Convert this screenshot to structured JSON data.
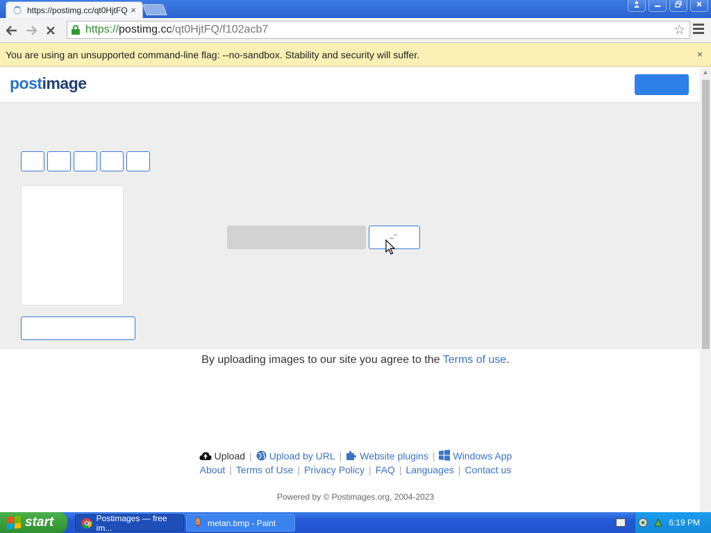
{
  "browser": {
    "tab_title": "https://postimg.cc/qt0HjtFQ",
    "tab_close": "×",
    "url_scheme": "https://",
    "url_host": "postimg.cc",
    "url_path": "/qt0HjtFQ/f102acb7"
  },
  "infobar": {
    "message": "You are using an unsupported command-line flag: --no-sandbox. Stability and security will suffer.",
    "close": "×"
  },
  "site": {
    "logo_part1": "post",
    "logo_part2": "image",
    "copy_button_label": "̶̶ ''",
    "terms_prefix": "By uploading images to our site you agree to the",
    "terms_link": "Terms of use",
    "terms_suffix": ".",
    "footer_row1": {
      "upload": "Upload",
      "upload_by_url": "Upload by URL",
      "website_plugins": "Website plugins",
      "windows_app": "Windows App"
    },
    "footer_row2": [
      "About",
      "Terms of Use",
      "Privacy Policy",
      "FAQ",
      "Languages",
      "Contact us"
    ],
    "powered": "Powered by © Postimages.org, 2004-2023",
    "separator": "|"
  },
  "taskbar": {
    "start_label": "start",
    "tasks": [
      {
        "label": "Postimages — free im...",
        "icon": "chrome-icon"
      },
      {
        "label": "metan.bmp - Paint",
        "icon": "paint-icon"
      }
    ],
    "clock": "6:19 PM"
  }
}
